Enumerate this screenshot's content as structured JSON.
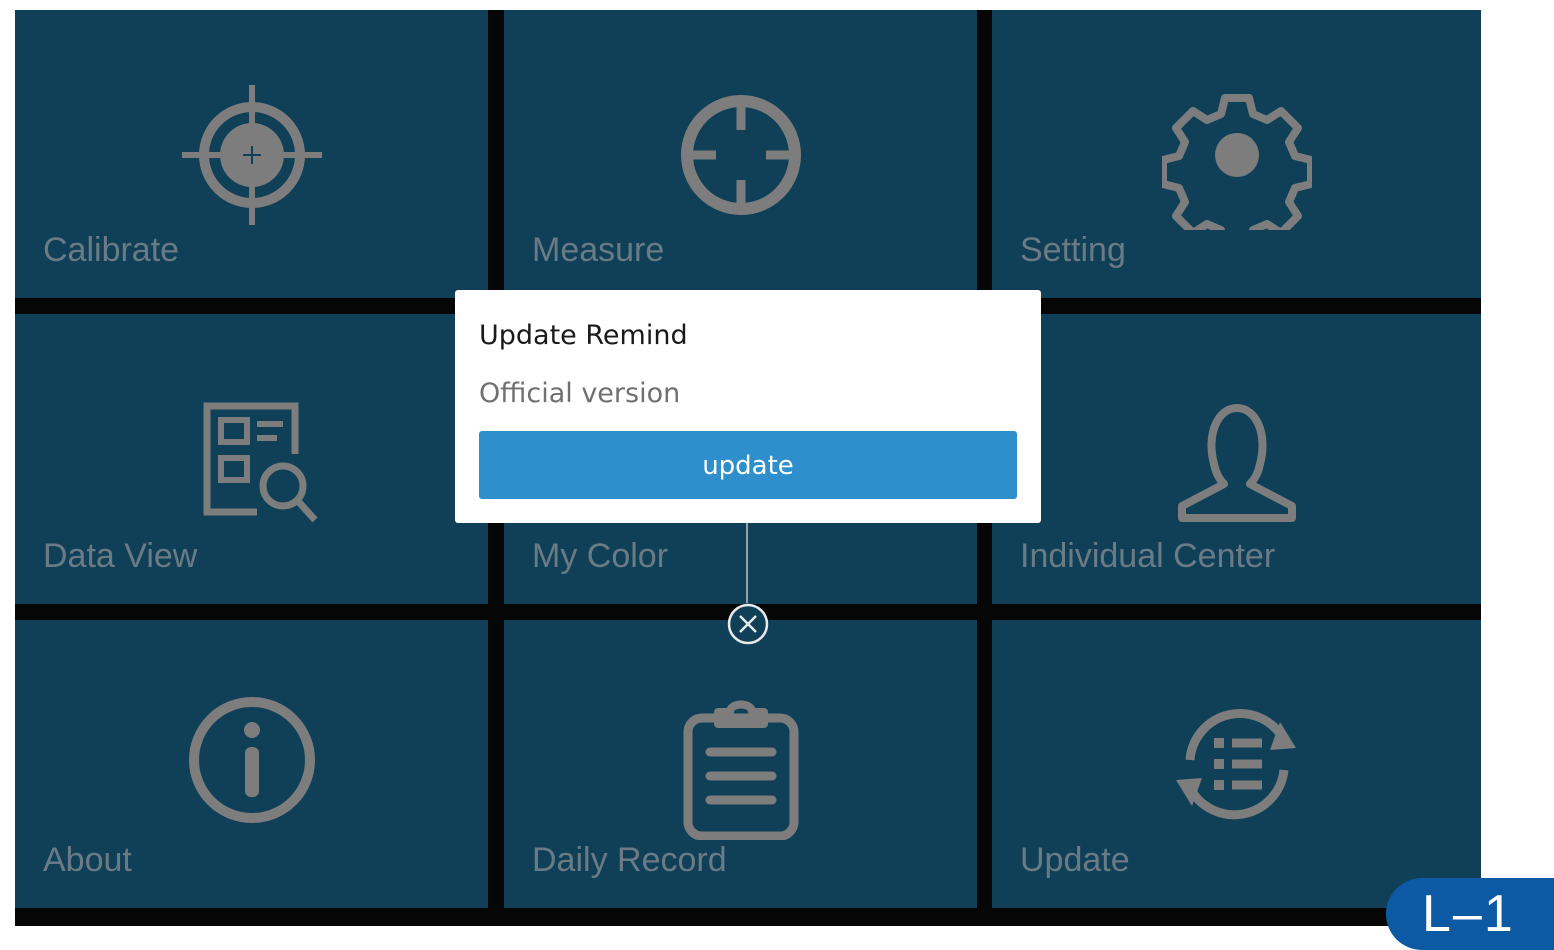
{
  "tiles": [
    {
      "label": "Calibrate",
      "icon": "crosshair-target-icon"
    },
    {
      "label": "Measure",
      "icon": "measure-crosshair-icon"
    },
    {
      "label": "Setting",
      "icon": "gear-icon"
    },
    {
      "label": "Data View",
      "icon": "data-view-icon"
    },
    {
      "label": "My Color",
      "icon": ""
    },
    {
      "label": "Individual Center",
      "icon": "user-icon"
    },
    {
      "label": "About",
      "icon": "info-icon"
    },
    {
      "label": "Daily Record",
      "icon": "clipboard-icon"
    },
    {
      "label": "Update",
      "icon": "update-list-icon"
    }
  ],
  "dialog": {
    "title": "Update Remind",
    "message": "Official version",
    "button_label": "update"
  },
  "close_icon": "close-circle-icon",
  "page_badge": "L–1",
  "colors": {
    "tile_bg": "#0f4058",
    "icon_gray": "#7d7d7d",
    "label_gray": "#6b7b85",
    "button_blue": "#2e8fcc",
    "badge_blue": "#0b5aa3"
  }
}
